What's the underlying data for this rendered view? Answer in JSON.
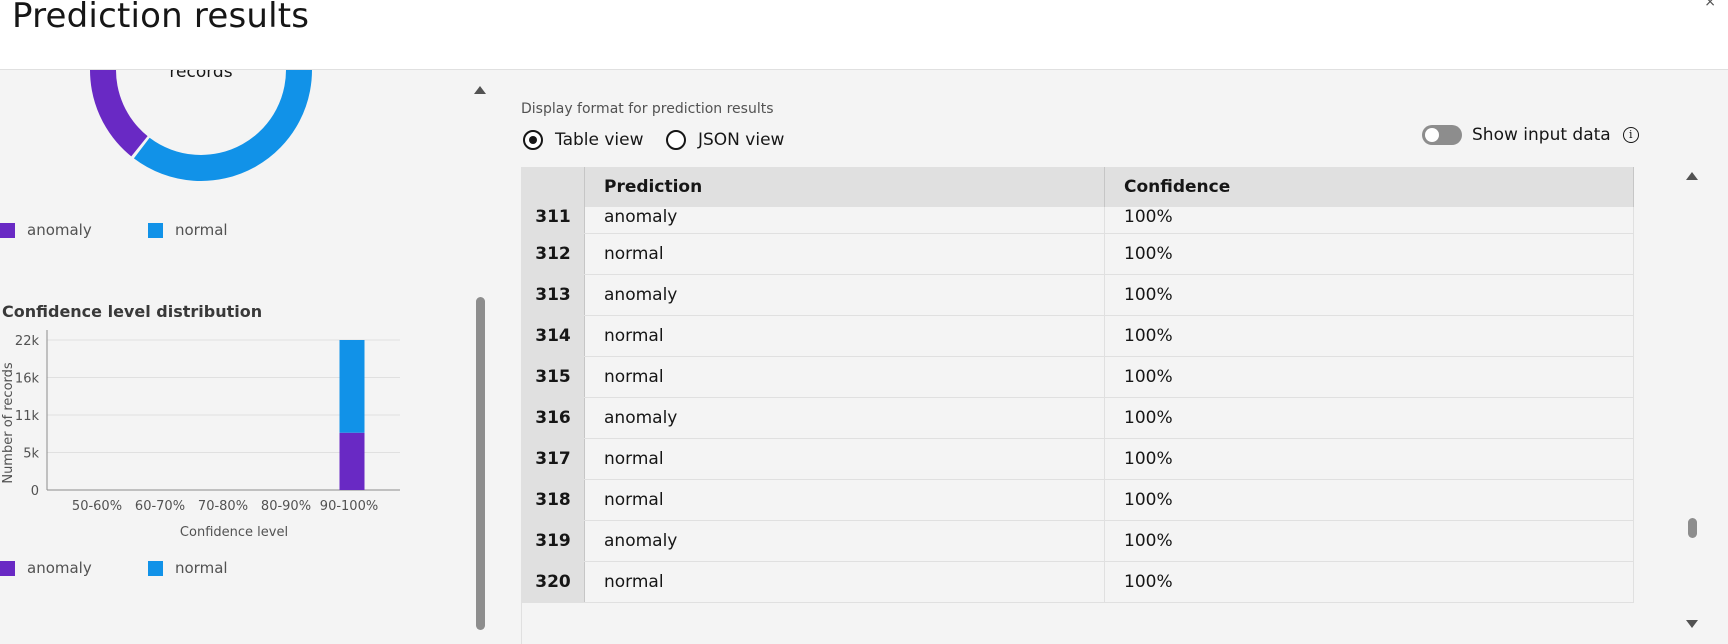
{
  "header": {
    "title": "Prediction results",
    "corner_glyph": "×"
  },
  "left": {
    "donut_center_text": "records",
    "legend_top": [
      {
        "label": "anomaly",
        "color": "#6929c4"
      },
      {
        "label": "normal",
        "color": "#1192e8"
      }
    ],
    "section_title": "Confidence level distribution",
    "legend_bottom": [
      {
        "label": "anomaly",
        "color": "#6929c4"
      },
      {
        "label": "normal",
        "color": "#1192e8"
      }
    ],
    "donut": {
      "anomaly_fraction": 0.37,
      "normal_fraction": 0.63
    }
  },
  "chart_data": {
    "type": "bar",
    "stacked": true,
    "categories": [
      "50-60%",
      "60-70%",
      "70-80%",
      "80-90%",
      "90-100%"
    ],
    "series": [
      {
        "name": "anomaly",
        "values": [
          0,
          0,
          0,
          0,
          8400
        ],
        "color": "#6929c4"
      },
      {
        "name": "normal",
        "values": [
          0,
          0,
          0,
          0,
          13600
        ],
        "color": "#1192e8"
      }
    ],
    "xlabel": "Confidence level",
    "ylabel": "Number of records",
    "yticks": [
      "0",
      "5k",
      "11k",
      "16k",
      "22k"
    ],
    "ytick_values": [
      0,
      5500,
      11000,
      16500,
      22000
    ],
    "ylim": [
      0,
      22000
    ],
    "grid": true
  },
  "right": {
    "format_label": "Display format for prediction results",
    "table_view_label": "Table view",
    "json_view_label": "JSON view",
    "selected_view": "table",
    "show_input_label": "Show input data",
    "show_input_on": false,
    "info_glyph": "i",
    "columns": [
      "",
      "Prediction",
      "Confidence"
    ],
    "rows": [
      {
        "idx": "311",
        "prediction": "anomaly",
        "confidence": "100%"
      },
      {
        "idx": "312",
        "prediction": "normal",
        "confidence": "100%"
      },
      {
        "idx": "313",
        "prediction": "anomaly",
        "confidence": "100%"
      },
      {
        "idx": "314",
        "prediction": "normal",
        "confidence": "100%"
      },
      {
        "idx": "315",
        "prediction": "normal",
        "confidence": "100%"
      },
      {
        "idx": "316",
        "prediction": "anomaly",
        "confidence": "100%"
      },
      {
        "idx": "317",
        "prediction": "normal",
        "confidence": "100%"
      },
      {
        "idx": "318",
        "prediction": "normal",
        "confidence": "100%"
      },
      {
        "idx": "319",
        "prediction": "anomaly",
        "confidence": "100%"
      },
      {
        "idx": "320",
        "prediction": "normal",
        "confidence": "100%"
      }
    ]
  }
}
